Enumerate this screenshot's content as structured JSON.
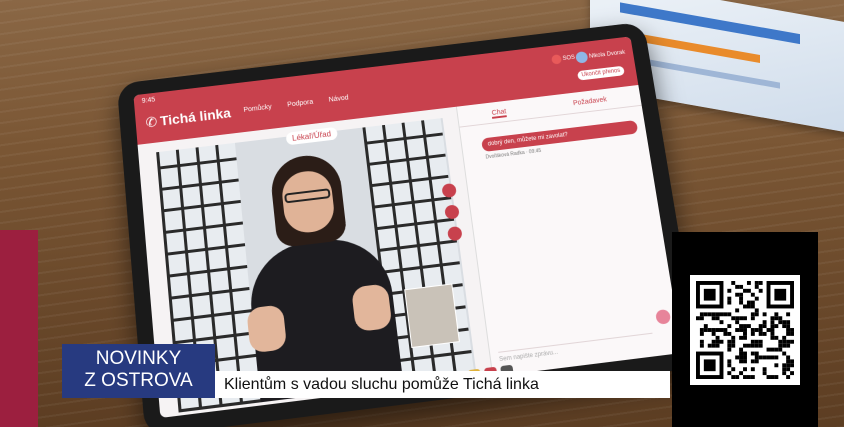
{
  "caption": {
    "show_tag_line1": "NOVINKY",
    "show_tag_line2": "Z OSTROVA",
    "headline": "Klientům s vadou sluchu pomůže Tichá linka",
    "accent_color": "#9c1f3f",
    "tag_color": "#273a80"
  },
  "tablet_app": {
    "time": "9:45",
    "brand": "Tichá linka",
    "nav": [
      "Pomůcky",
      "Podpora",
      "Návod"
    ],
    "sos": "SOS",
    "user": "Nikola Dvorak",
    "end_call": "Ukončit přenos",
    "video_header": "Lékař/Úřad",
    "chat_tabs": [
      "Chat",
      "Požadavek"
    ],
    "chat_message": "dobrý den, můžete mi zavolat?",
    "chat_meta": "Dvořáková Radka · 09:45",
    "chat_placeholder": "Sem napište zprávu...",
    "brand_color": "#c8414d"
  },
  "qr": {
    "label": "qr-code"
  }
}
